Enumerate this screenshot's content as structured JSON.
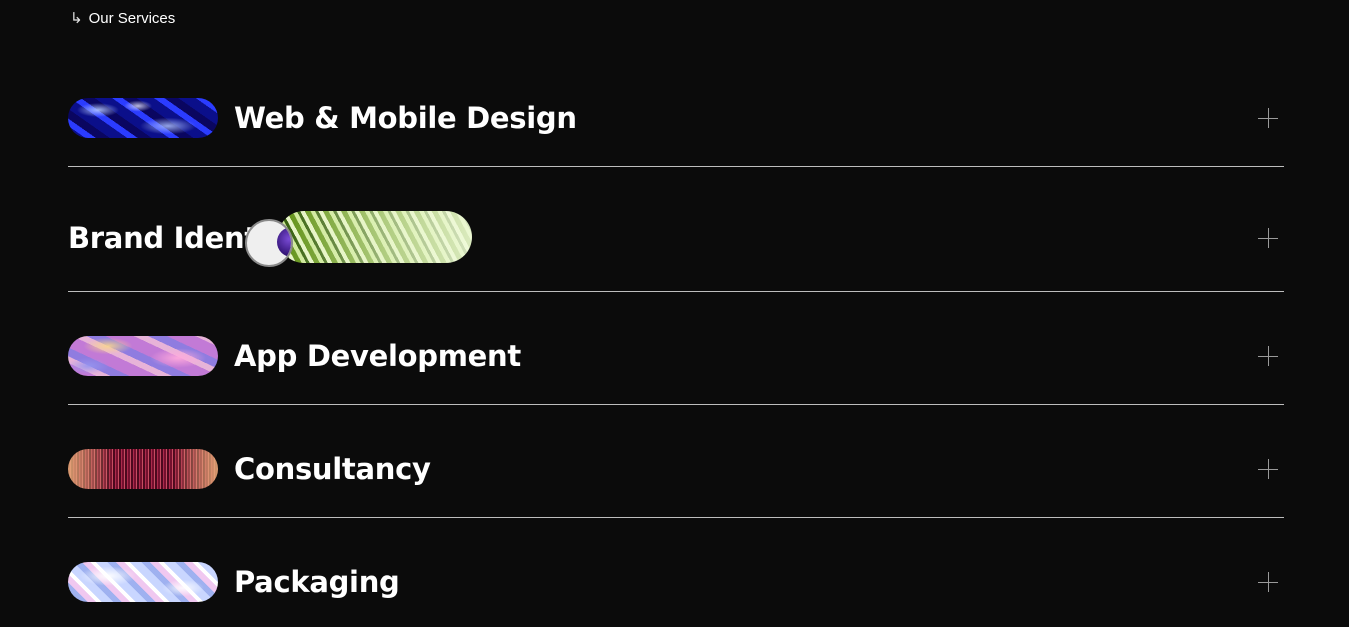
{
  "section": {
    "eyebrow_arrow": "↳",
    "eyebrow_label": "Our Services"
  },
  "services": [
    {
      "title": "Web & Mobile Design",
      "thumbnail": "blue-chrome-abstract",
      "expanded": false
    },
    {
      "title": "Brand Identity",
      "thumbnail": "green-stripe-abstract",
      "expanded": false,
      "hovered": true
    },
    {
      "title": "App Development",
      "thumbnail": "pastel-iridescent-abstract",
      "expanded": false
    },
    {
      "title": "Consultancy",
      "thumbnail": "crimson-vertical-lines-abstract",
      "expanded": false
    },
    {
      "title": "Packaging",
      "thumbnail": "holographic-foil-abstract",
      "expanded": false
    }
  ],
  "icons": {
    "expand": "plus-icon",
    "eyebrow": "return-arrow-icon",
    "cursor": "cursor-circle"
  },
  "colors": {
    "background": "#0b0b0b",
    "text": "#ffffff",
    "divider": "#bdbdbd",
    "plus": "#9a9a9a"
  }
}
